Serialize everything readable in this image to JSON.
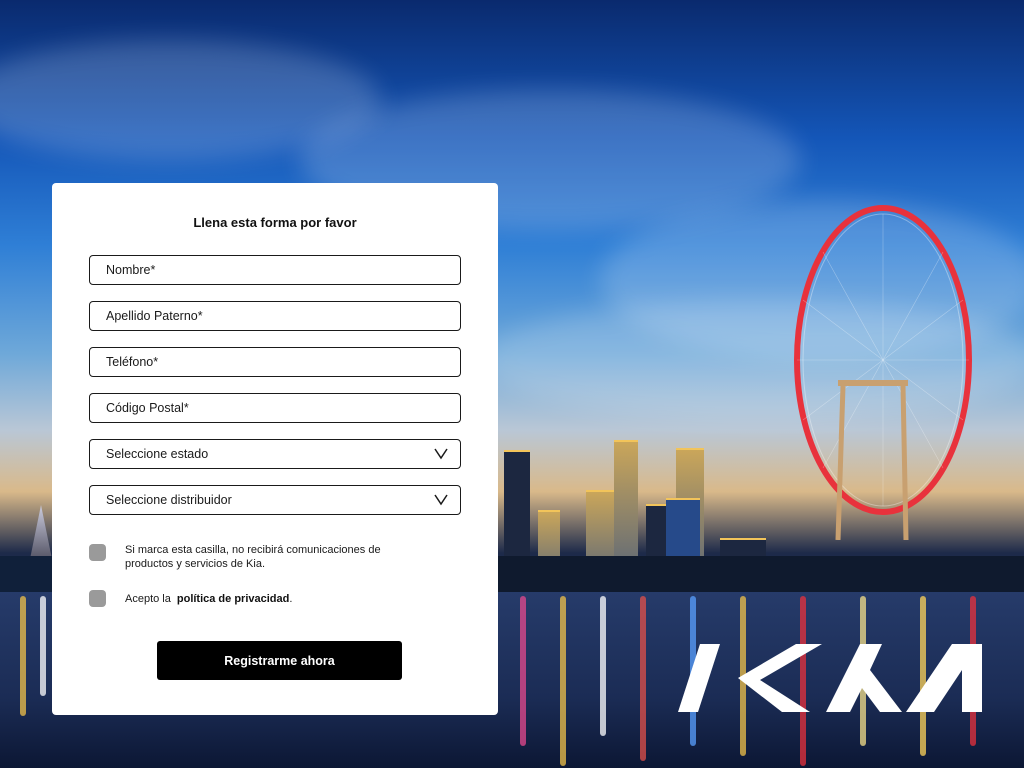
{
  "form": {
    "title": "Llena esta forma por favor",
    "fields": [
      {
        "placeholder": "Nombre*",
        "value": ""
      },
      {
        "placeholder": "Apellido Paterno*",
        "value": ""
      },
      {
        "placeholder": "Teléfono*",
        "value": ""
      },
      {
        "placeholder": "Código Postal*",
        "value": ""
      }
    ],
    "selects": [
      {
        "selected": "Seleccione estado"
      },
      {
        "selected": "Seleccione distribuidor"
      }
    ],
    "checkboxes": [
      {
        "label": "Si marca esta casilla, no recibirá comunicaciones de productos y servicios de Kia.",
        "checked": false
      },
      {
        "label_prefix": "Acepto la",
        "link_text": "política de privacidad",
        "label_suffix": ".",
        "checked": false
      }
    ],
    "submit_label": "Registrarme  ahora"
  },
  "brand": {
    "logo_icon": "kia-logo",
    "logo_text": "KIA"
  },
  "colors": {
    "button": "#000000",
    "checkbox": "#9a9a9a",
    "card": "#ffffff"
  }
}
